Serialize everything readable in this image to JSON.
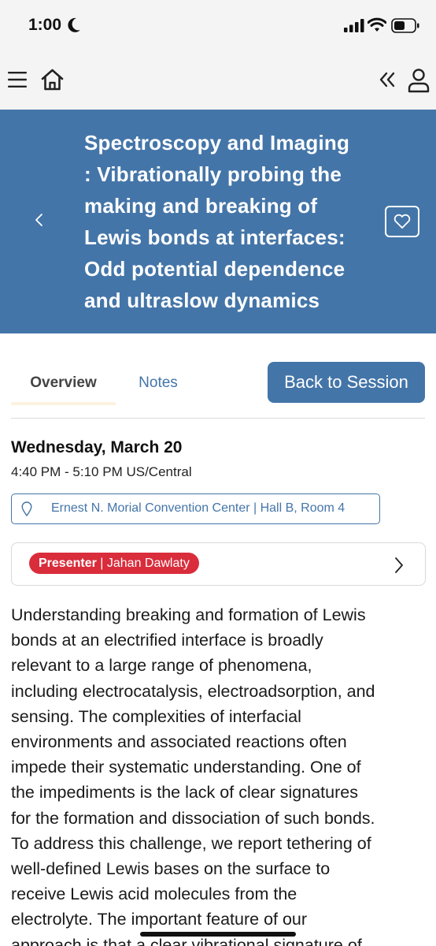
{
  "status_bar": {
    "time": "1:00"
  },
  "icons": {
    "moon": "moon-icon",
    "signal": "signal-icon",
    "wifi": "wifi-icon",
    "battery": "battery-icon",
    "menu": "menu-icon",
    "home": "home-icon",
    "collapse": "double-chevron-left-icon",
    "profile": "user-icon",
    "back": "chevron-left-icon",
    "favorite": "heart-icon",
    "location": "location-pin-icon",
    "presenter_more": "chevron-right-icon"
  },
  "colors": {
    "brand_blue": "#4475a8",
    "presenter_red": "#d92d3c",
    "tab_accent": "#fdf2de"
  },
  "hero": {
    "title_lines": [
      "Spectroscopy and Imaging",
      ": Vibrationally probing the",
      "making and breaking of",
      "Lewis bonds at interfaces:",
      "Odd potential dependence",
      "and ultraslow dynamics"
    ]
  },
  "tabs": {
    "overview": "Overview",
    "notes": "Notes",
    "back_to_session": "Back to Session"
  },
  "session": {
    "date": "Wednesday, March 20",
    "time": "4:40 PM - 5:10 PM US/Central",
    "location": "Ernest N. Morial Convention Center | Hall B, Room 4"
  },
  "presenter": {
    "role": "Presenter",
    "separator": " | ",
    "name": "Jahan Dawlaty"
  },
  "abstract_lines": [
    "Understanding breaking and formation of Lewis",
    "bonds at an electrified interface is broadly",
    "relevant to a large range of phenomena,",
    "including electrocatalysis, electroadsorption, and",
    "sensing. The complexities of interfacial",
    "environments and associated reactions often",
    "impede their systematic understanding. One of",
    "the impediments is the lack of clear signatures",
    "for the formation and dissociation of such bonds.",
    "To address this challenge, we report tethering of",
    "well-defined Lewis bases on the surface to",
    "receive Lewis acid molecules from the",
    "electrolyte. The important feature of our",
    "approach is that a clear vibrational signature of"
  ]
}
